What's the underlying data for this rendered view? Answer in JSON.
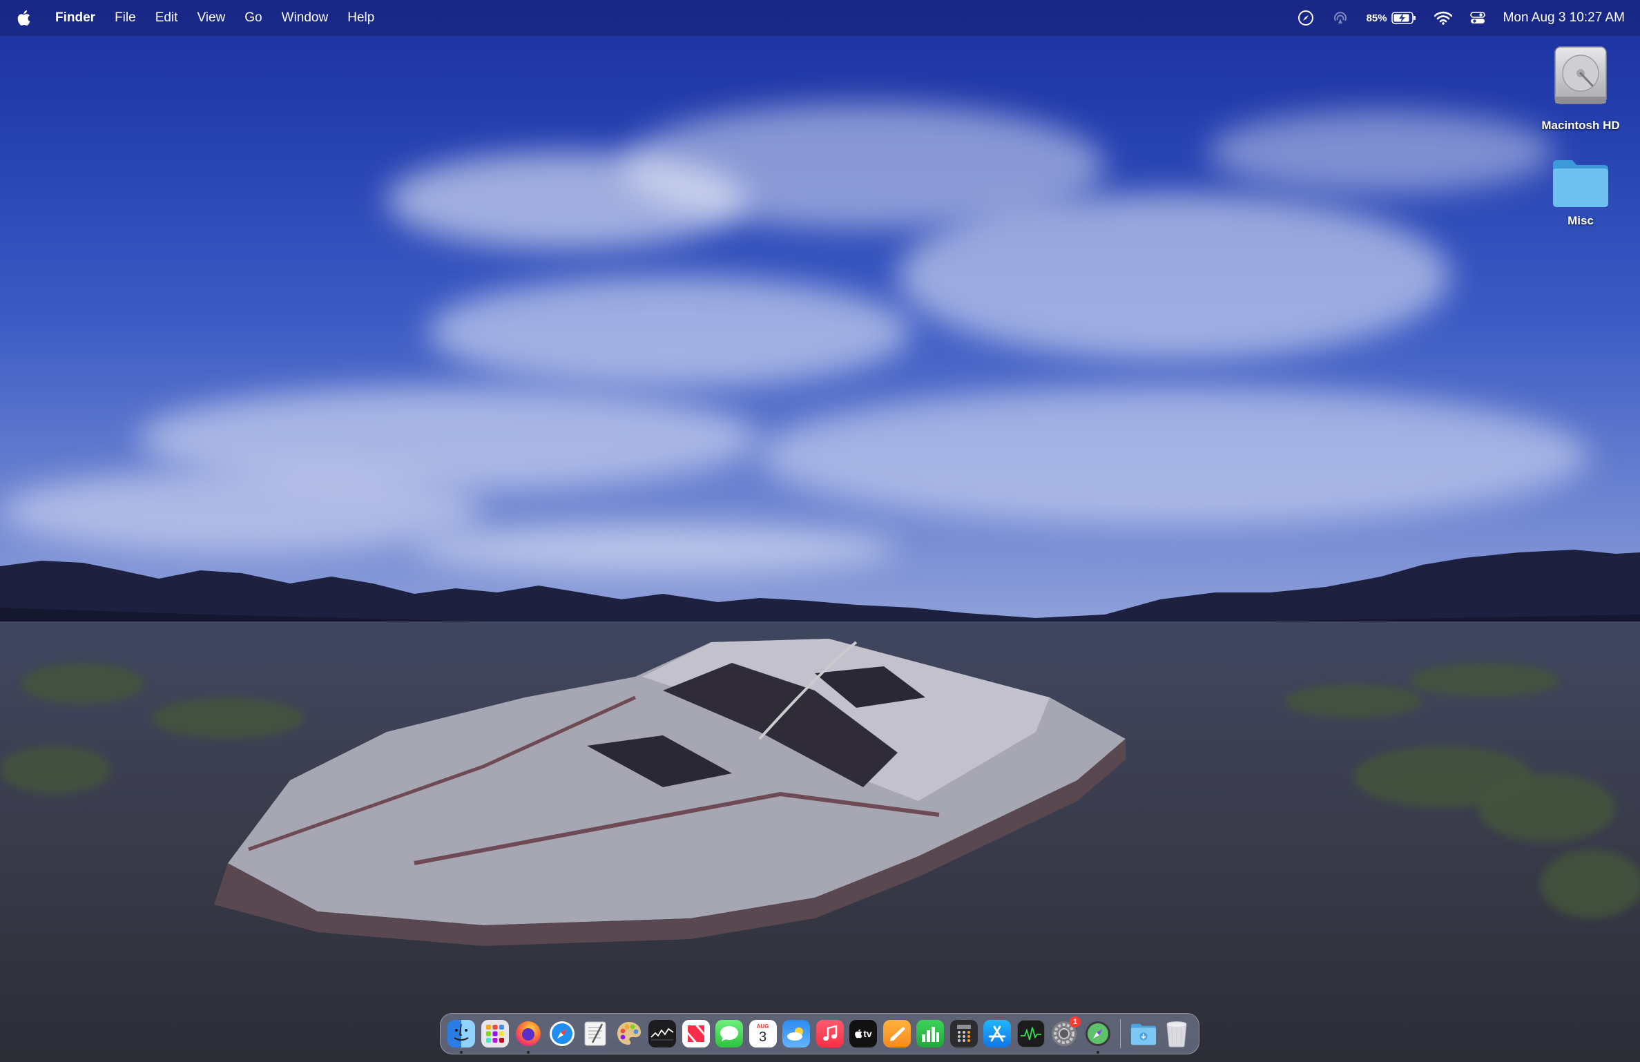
{
  "menubar": {
    "app_name": "Finder",
    "menus": [
      "File",
      "Edit",
      "View",
      "Go",
      "Window",
      "Help"
    ],
    "status": {
      "battery_percent": "85%",
      "clock": "Mon Aug 3  10:27 AM"
    }
  },
  "desktop": {
    "icons": [
      {
        "label": "Macintosh HD",
        "icon": "hard-drive-icon"
      },
      {
        "label": "Misc",
        "icon": "folder-icon"
      }
    ]
  },
  "dock": {
    "apps": [
      {
        "name": "finder",
        "running": true
      },
      {
        "name": "launchpad",
        "running": false
      },
      {
        "name": "firefox",
        "running": true
      },
      {
        "name": "safari",
        "running": false
      },
      {
        "name": "textedit",
        "running": false
      },
      {
        "name": "color-picker",
        "running": false
      },
      {
        "name": "stocks",
        "running": false
      },
      {
        "name": "news",
        "running": false
      },
      {
        "name": "messages",
        "running": false
      },
      {
        "name": "calendar",
        "running": false
      },
      {
        "name": "weather",
        "running": false
      },
      {
        "name": "music",
        "running": false
      },
      {
        "name": "tv",
        "running": false
      },
      {
        "name": "pages",
        "running": false
      },
      {
        "name": "numbers",
        "running": false
      },
      {
        "name": "calculator",
        "running": false
      },
      {
        "name": "app-store",
        "running": false
      },
      {
        "name": "activity-monitor",
        "running": false
      },
      {
        "name": "system-settings",
        "running": false
      },
      {
        "name": "safari-technology-preview",
        "running": true
      }
    ],
    "calendar": {
      "month": "AUG",
      "day": "3"
    },
    "tv_label": "tv",
    "settings_badge": "1",
    "stacks": [
      {
        "name": "downloads-folder"
      },
      {
        "name": "trash"
      }
    ]
  }
}
